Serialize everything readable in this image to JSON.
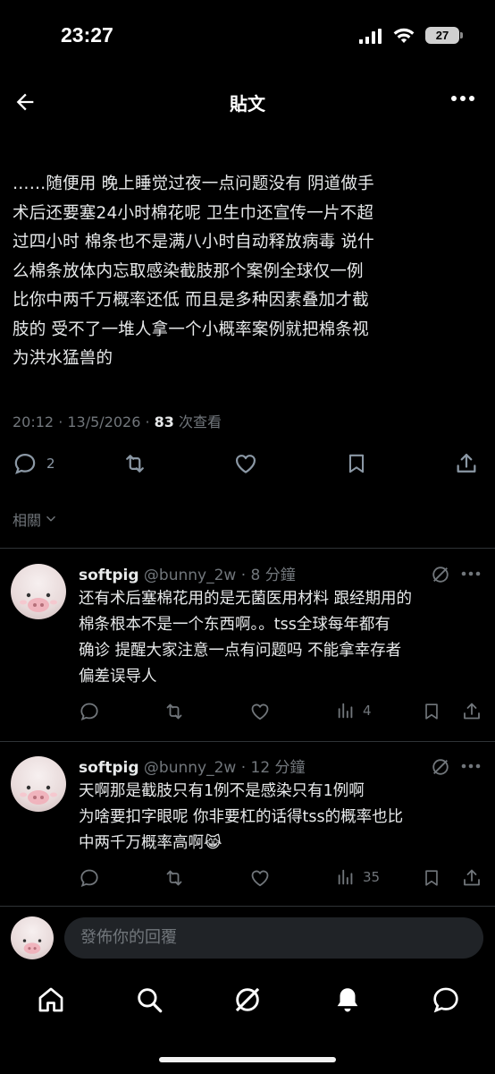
{
  "status_bar": {
    "time": "23:27",
    "battery": "27",
    "icons": [
      "signal-icon",
      "wifi-icon",
      "battery-icon"
    ]
  },
  "header": {
    "title": "貼文",
    "back_icon": "arrow-left-icon",
    "more_icon": "more-horizontal-icon"
  },
  "post": {
    "lines": [
      "……随便用 晚上睡觉过夜一点问题没有 阴道做手",
      "术后还要塞24小时棉花呢 卫生巾还宣传一片不超",
      "过四小时 棉条也不是满八小时自动释放病毒 说什",
      "么棉条放体内忘取感染截肢那个案例全球仅一例",
      "比你中两千万概率还低 而且是多种因素叠加才截",
      "肢的 受不了一堆人拿一个小概率案例就把棉条视",
      "为洪水猛兽的"
    ],
    "meta_time": "20:12 · 13/5/2026 · ",
    "views_count": "83",
    "views_label": " 次查看",
    "reply_count": "2",
    "related_label": "相關"
  },
  "replies": [
    {
      "name": "softpig",
      "handle": " @bunny_2w · 8 分鐘",
      "lines": [
        "还有术后塞棉花用的是无菌医用材料 跟经期用的",
        "棉条根本不是一个东西啊。。tss全球每年都有",
        "确诊 提醒大家注意一点有问题吗 不能拿幸存者",
        "偏差误导人"
      ],
      "views": "4"
    },
    {
      "name": "softpig",
      "handle": " @bunny_2w · 12 分鐘",
      "lines": [
        "天啊那是截肢只有1例不是感染只有1例啊",
        "为啥要扣字眼呢 你非要杠的话得tss的概率也比",
        "中两千万概率高啊😹"
      ],
      "views": "35"
    }
  ],
  "composer": {
    "placeholder": "發佈你的回覆"
  },
  "nav": {
    "icons": [
      "home-icon",
      "search-icon",
      "grok-icon",
      "notifications-icon",
      "messages-icon"
    ]
  },
  "colors": {
    "background": "#000000",
    "text": "#e7e9ea",
    "muted": "#71767b",
    "divider": "#2f3336",
    "input_bg": "#202327"
  }
}
